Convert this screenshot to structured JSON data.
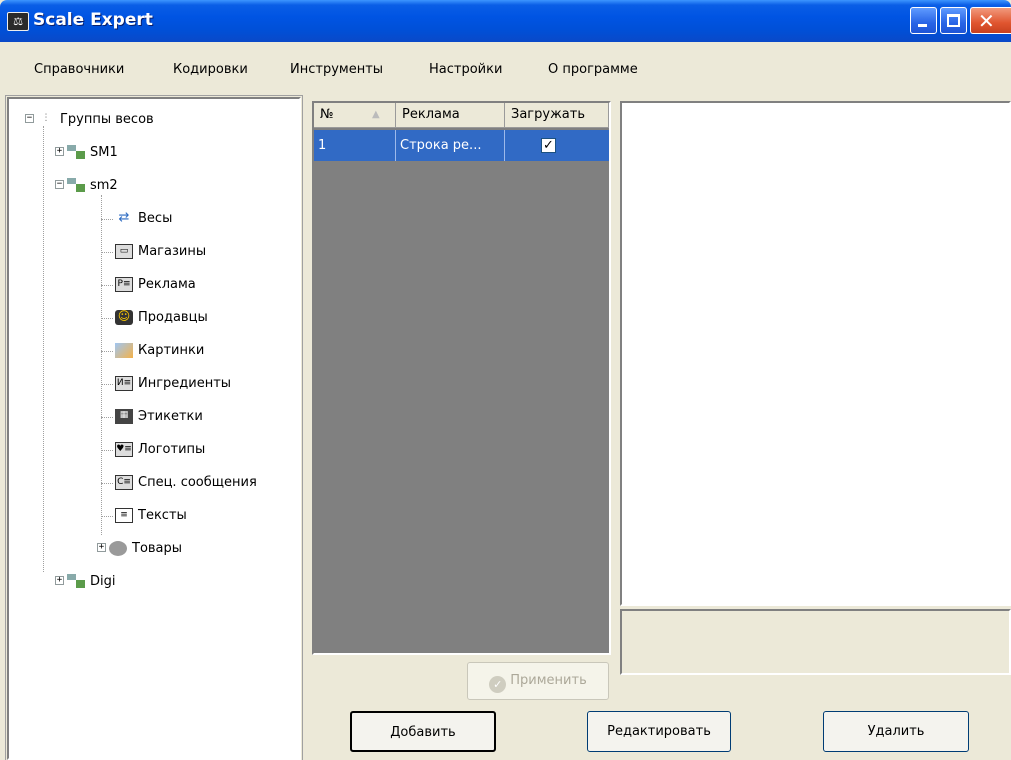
{
  "window": {
    "title": "Scale Expert"
  },
  "menu": [
    "Справочники",
    "Кодировки",
    "Инструменты",
    "Настройки",
    "О программе"
  ],
  "tree": {
    "root": "Группы весов",
    "groups": [
      {
        "label": "SM1",
        "expanded": false
      },
      {
        "label": "sm2",
        "expanded": true,
        "children": [
          "Весы",
          "Магазины",
          "Реклама",
          "Продавцы",
          "Картинки",
          "Ингредиенты",
          "Этикетки",
          "Логотипы",
          "Спец. сообщения",
          "Тексты",
          "Товары"
        ]
      },
      {
        "label": "Digi",
        "expanded": false
      }
    ]
  },
  "grid": {
    "columns": [
      "№",
      "Реклама",
      "Загружать"
    ],
    "rows": [
      {
        "num": "1",
        "name": "Строка ре...",
        "load": true
      }
    ]
  },
  "buttons": {
    "apply": "Применить",
    "add": "Добавить",
    "edit": "Редактировать",
    "delete": "Удалить"
  }
}
